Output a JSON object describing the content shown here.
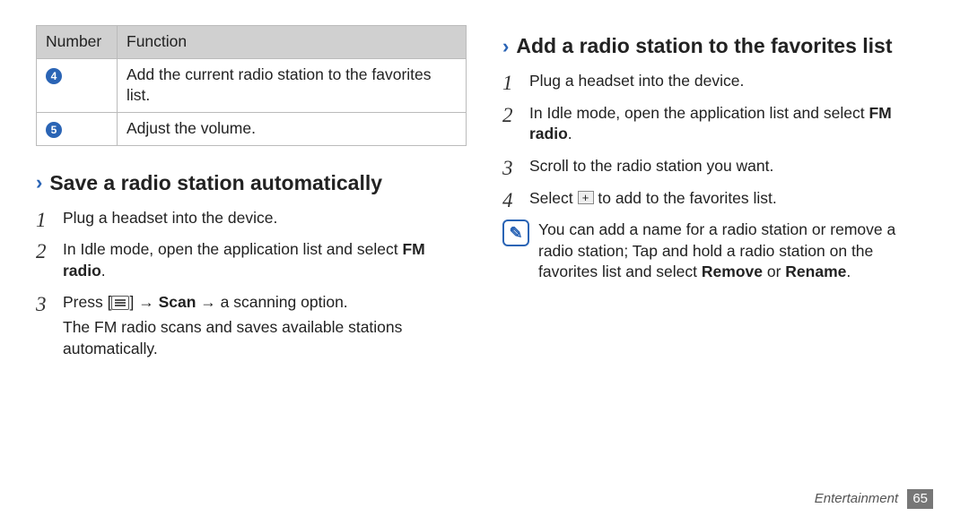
{
  "table": {
    "headers": {
      "number": "Number",
      "function": "Function"
    },
    "rows": [
      {
        "num": "4",
        "fn": "Add the current radio station to the favorites list."
      },
      {
        "num": "5",
        "fn": "Adjust the volume."
      }
    ]
  },
  "left": {
    "heading": "Save a radio station automatically",
    "steps": {
      "s1": "Plug a headset into the device.",
      "s2a": "In Idle mode, open the application list and select ",
      "s2b": "FM radio",
      "s2c": ".",
      "s3a": "Press [",
      "s3b": "] → ",
      "s3c": "Scan",
      "s3d": " → a scanning option.",
      "s3after": "The FM radio scans and saves available stations automatically."
    }
  },
  "right": {
    "heading": "Add a radio station to the favorites list",
    "steps": {
      "s1": "Plug a headset into the device.",
      "s2a": "In Idle mode, open the application list and select ",
      "s2b": "FM radio",
      "s2c": ".",
      "s3": "Scroll to the radio station you want.",
      "s4a": "Select ",
      "s4b": " to add to the favorites list."
    },
    "note_a": "You can add a name for a radio station or remove a radio station; Tap and hold a radio station on the favorites list and select ",
    "note_b": "Remove",
    "note_c": " or ",
    "note_d": "Rename",
    "note_e": "."
  },
  "footer": {
    "chapter": "Entertainment",
    "page": "65"
  },
  "glyphs": {
    "plus": "+",
    "note": "✎"
  }
}
